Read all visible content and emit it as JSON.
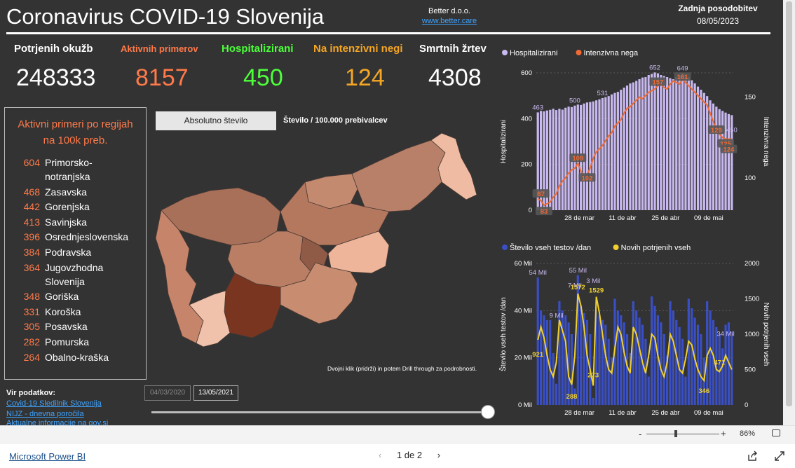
{
  "header": {
    "title": "Coronavirus COVID-19 Slovenija",
    "company": "Better d.o.o.",
    "company_url": "www.better.care",
    "update_label": "Zadnja posodobitev",
    "update_date": "08/05/2023"
  },
  "kpis": [
    {
      "label": "Potrjenih okužb",
      "value": "248333",
      "color": "#ffffff"
    },
    {
      "label": "Aktivnih primerov",
      "value": "8157",
      "color": "#ff7a4a"
    },
    {
      "label": "Hospitalizirani",
      "value": "450",
      "color": "#4cff3a"
    },
    {
      "label": "Na intenzivni negi",
      "value": "124",
      "color": "#f5a623"
    },
    {
      "label": "Smrtnih žrtev",
      "value": "4308",
      "color": "#ffffff"
    }
  ],
  "regions": {
    "title": "Aktivni primeri po regijah na 100k preb.",
    "items": [
      {
        "value": "604",
        "name": "Primorsko-notranjska"
      },
      {
        "value": "468",
        "name": "Zasavska"
      },
      {
        "value": "442",
        "name": "Gorenjska"
      },
      {
        "value": "413",
        "name": "Savinjska"
      },
      {
        "value": "396",
        "name": "Osrednjeslovenska"
      },
      {
        "value": "384",
        "name": "Podravska"
      },
      {
        "value": "364",
        "name": "Jugovzhodna Slovenija"
      },
      {
        "value": "348",
        "name": "Goriška"
      },
      {
        "value": "331",
        "name": "Koroška"
      },
      {
        "value": "305",
        "name": "Posavska"
      },
      {
        "value": "282",
        "name": "Pomurska"
      },
      {
        "value": "264",
        "name": "Obalno-kraška"
      }
    ]
  },
  "map_controls": {
    "absolute_label": "Absolutno število",
    "per_capita_label": "Število / 100.000 prebivalcev",
    "drill_hint": "Dvojni klik (pridrži) in potem Drill through za podrobnosti."
  },
  "sources": {
    "label": "Vir podatkov:",
    "links": [
      "Covid-19 Sledilnik Slovenija",
      "NIJZ - dnevna poročila",
      "Aktualne informacije na gov.si"
    ]
  },
  "date_range": {
    "start": "04/03/2020",
    "end": "13/05/2021"
  },
  "colors": {
    "hosp": "#c9b9f0",
    "icu": "#f06a32",
    "tests": "#3a4fc4",
    "confirmed": "#f0d030",
    "accent": "#ff7a4a"
  },
  "chart_data": [
    {
      "type": "bar",
      "legend": [
        "Hospitalizirani",
        "Intenzivna nega"
      ],
      "ylabel": "Hospitalizirani",
      "y2label": "Intenzivna nega",
      "yticks": [
        "600",
        "400",
        "200",
        "0"
      ],
      "y2ticks": [
        "150",
        "100"
      ],
      "xticks": [
        "28 de mar",
        "11 de abr",
        "25 de abr",
        "09 de mai"
      ],
      "ylim": [
        0,
        650
      ],
      "y2lim": [
        80,
        165
      ],
      "series": [
        {
          "name": "Hospitalizirani",
          "values": [
            463,
            470,
            468,
            472,
            475,
            480,
            474,
            480,
            476,
            485,
            490,
            488,
            495,
            500,
            498,
            505,
            510,
            512,
            515,
            520,
            525,
            531,
            535,
            540,
            548,
            555,
            560,
            570,
            580,
            590,
            600,
            605,
            612,
            620,
            628,
            630,
            640,
            645,
            652,
            648,
            640,
            635,
            630,
            625,
            620,
            630,
            640,
            649,
            640,
            630,
            615,
            600,
            585,
            570,
            555,
            540,
            520,
            505,
            490,
            478,
            470,
            462,
            455,
            450
          ]
        },
        {
          "name": "Intenzivna nega",
          "values": [
            87,
            86,
            83,
            84,
            85,
            88,
            90,
            95,
            98,
            100,
            103,
            105,
            106,
            109,
            104,
            100,
            102,
            106,
            112,
            116,
            118,
            120,
            123,
            126,
            128,
            132,
            134,
            136,
            140,
            143,
            144,
            146,
            148,
            150,
            149,
            151,
            153,
            154,
            155,
            157,
            158,
            156,
            155,
            158,
            160,
            159,
            158,
            161,
            159,
            157,
            155,
            153,
            151,
            149,
            147,
            145,
            140,
            135,
            129,
            127,
            125,
            124,
            124,
            124
          ]
        }
      ],
      "labels_hosp": [
        "463",
        "500",
        "531",
        "652",
        "649",
        "450"
      ],
      "labels_icu": [
        "87",
        "83",
        "109",
        "102",
        "157",
        "161",
        "129",
        "125",
        "124"
      ]
    },
    {
      "type": "bar",
      "legend": [
        "Število vseh testov /dan",
        "Novih potrjenih vseh"
      ],
      "ylabel": "Število vseh testov /dan",
      "y2label": "Novih potrjenih vseh",
      "yticks": [
        "60 Mil",
        "40 Mil",
        "20 Mil",
        "0 Mil"
      ],
      "y2ticks": [
        "2000",
        "1500",
        "1000",
        "500",
        "0"
      ],
      "xticks": [
        "28 de mar",
        "11 de abr",
        "25 de abr",
        "09 de mai"
      ],
      "ylim": [
        0,
        60
      ],
      "y2lim": [
        0,
        2000
      ],
      "series": [
        {
          "name": "Število vseh testov /dan",
          "values": [
            54,
            40,
            38,
            36,
            36,
            22,
            9,
            44,
            40,
            38,
            35,
            30,
            7,
            55,
            42,
            39,
            36,
            30,
            3,
            40,
            38,
            36,
            34,
            28,
            20,
            45,
            40,
            38,
            35,
            30,
            22,
            44,
            40,
            37,
            34,
            28,
            12,
            46,
            42,
            38,
            35,
            30,
            21,
            44,
            40,
            36,
            33,
            28,
            12,
            45,
            41,
            37,
            34,
            30,
            20,
            44,
            40,
            36,
            33,
            30,
            24,
            34,
            35,
            31
          ]
        },
        {
          "name": "Novih potrjenih vseh",
          "values": [
            921,
            1100,
            950,
            700,
            500,
            400,
            600,
            1200,
            1050,
            900,
            400,
            288,
            700,
            1572,
            1400,
            1100,
            700,
            500,
            273,
            1529,
            1300,
            1000,
            700,
            500,
            450,
            800,
            1100,
            1000,
            750,
            550,
            450,
            1100,
            1000,
            800,
            600,
            450,
            700,
            1000,
            950,
            700,
            500,
            400,
            600,
            1000,
            900,
            700,
            500,
            450,
            650,
            900,
            850,
            650,
            500,
            400,
            346,
            700,
            800,
            700,
            500,
            471,
            550,
            700,
            600,
            500
          ]
        }
      ],
      "labels_tests": [
        "54 Mil",
        "55 Mil",
        "9 Mil",
        "7 Mil",
        "3 Mil",
        "34 Mil"
      ],
      "labels_conf": [
        "921",
        "1572",
        "1529",
        "288",
        "273",
        "346",
        "471"
      ]
    }
  ],
  "statusbar": {
    "zoom": "86%",
    "minus": "-",
    "plus": "+"
  },
  "bottombar": {
    "product": "Microsoft Power BI",
    "page": "1 de 2"
  }
}
